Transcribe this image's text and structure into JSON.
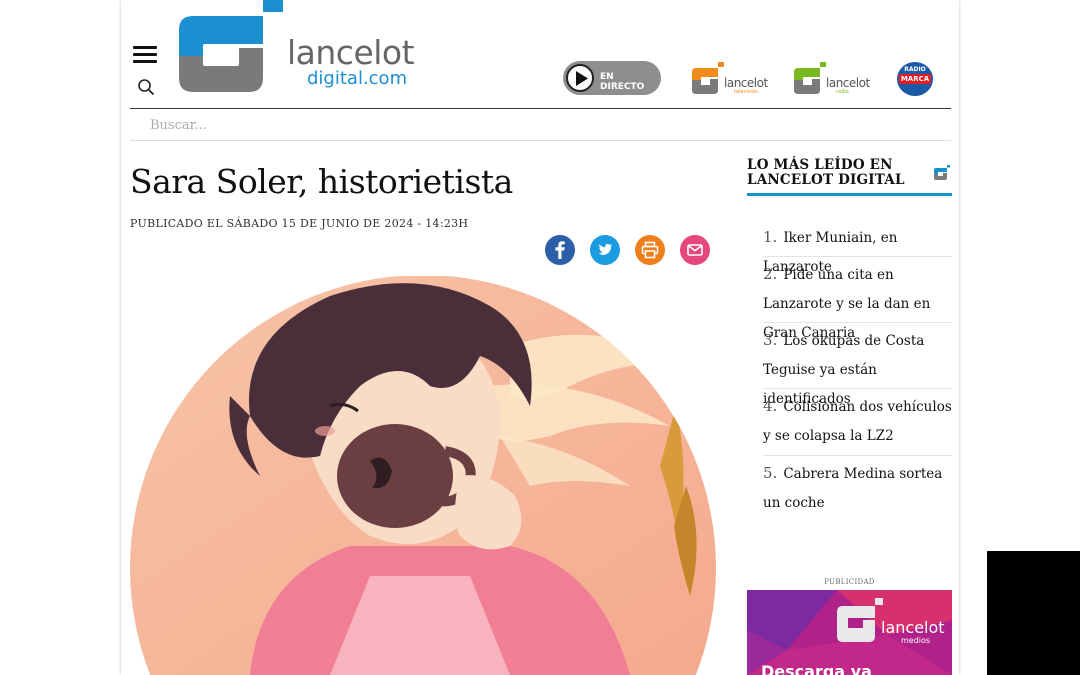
{
  "brand": {
    "line1": "lancelot",
    "line2": "digital.com",
    "blue": "#1b8fd0",
    "gray": "#7a7a7a"
  },
  "header": {
    "menu_icon": "hamburger-icon",
    "search_icon": "search-icon",
    "live_label": "EN DIRECTO",
    "channels": [
      {
        "name": "lancelot",
        "sub": "televisión",
        "accent": "#f08a1c"
      },
      {
        "name": "lancelot",
        "sub": "radio",
        "accent": "#7ab81f"
      }
    ],
    "radio_marca": {
      "top": "RADIO",
      "name": "MARCA"
    }
  },
  "search": {
    "placeholder": "Buscar..."
  },
  "article": {
    "title": "Sara Soler, historietista",
    "published": "PUBLICADO EL SÁBADO 15 DE JUNIO DE 2024 - 14:23H",
    "share": [
      {
        "icon": "facebook-icon",
        "color": "#2d5fa8"
      },
      {
        "icon": "twitter-icon",
        "color": "#1b9be0"
      },
      {
        "icon": "print-icon",
        "color": "#ef7f1a"
      },
      {
        "icon": "mail-icon",
        "color": "#e6467e"
      }
    ]
  },
  "sidebar": {
    "title": "LO MÁS LEÍDO EN LANCELOT DIGITAL",
    "most_read": [
      {
        "num": "1.",
        "text": "Iker Muniain, en Lanzarote"
      },
      {
        "num": "2.",
        "text": "Pide una cita en Lanzarote y se la dan en Gran Canaria"
      },
      {
        "num": "3.",
        "text": "Los okupas de Costa Teguise ya están identificados"
      },
      {
        "num": "4.",
        "text": "Colisionan dos vehículos y se colapsa la LZ2"
      },
      {
        "num": "5.",
        "text": "Cabrera Medina sortea un coche"
      }
    ],
    "ad_label": "PUBLICIDAD",
    "ad": {
      "brand": "lancelot",
      "sub": "medios",
      "cta": "Descarga ya"
    }
  }
}
